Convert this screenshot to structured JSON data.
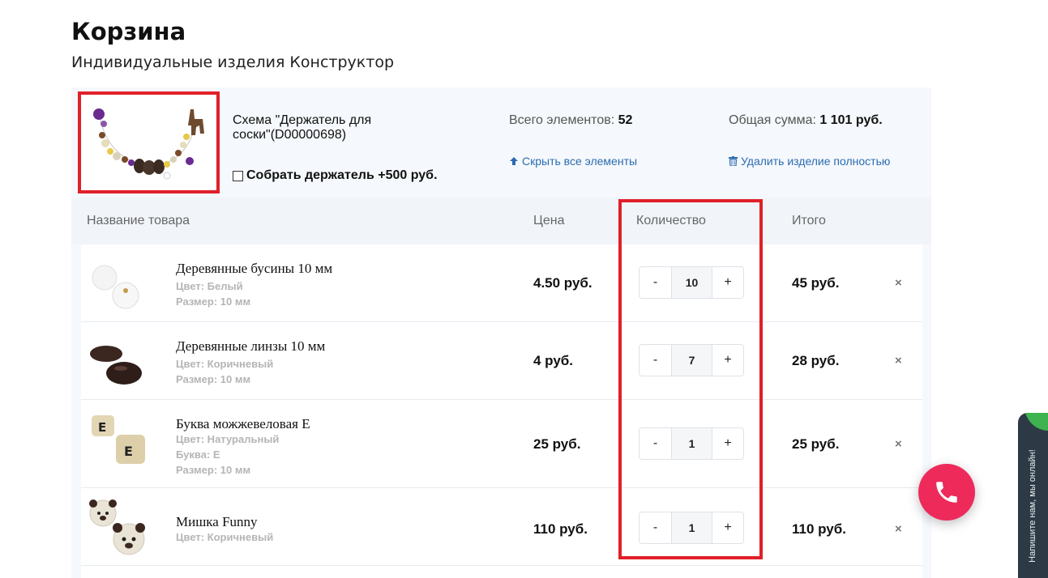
{
  "page": {
    "title": "Корзина",
    "subtitle": "Индивидуальные изделия Конструктор"
  },
  "product": {
    "scheme_title": "Схема \"Держатель для соски\"(D00000698)",
    "assemble_label": "Собрать держатель +500 руб.",
    "assemble_checked": false,
    "total_elements_label": "Всего элементов:",
    "total_elements_value": "52",
    "total_sum_label": "Общая сумма:",
    "total_sum_value": "1 101 руб.",
    "hide_all_label": "Скрыть все элементы",
    "delete_label": "Удалить изделие полностью"
  },
  "table": {
    "headers": {
      "name": "Название товара",
      "price": "Цена",
      "quantity": "Количество",
      "total": "Итого"
    },
    "rows": [
      {
        "name": "Деревянные бусины 10 мм",
        "props": [
          "Цвет: Белый",
          "Размер: 10 мм"
        ],
        "price": "4.50 руб.",
        "qty": "10",
        "total": "45 руб."
      },
      {
        "name": "Деревянные линзы 10 мм",
        "props": [
          "Цвет: Коричневый",
          "Размер: 10 мм"
        ],
        "price": "4 руб.",
        "qty": "7",
        "total": "28 руб."
      },
      {
        "name": "Буква можжевеловая E",
        "props": [
          "Цвет: Натуральный",
          "Буква: E",
          "Размер: 10 мм"
        ],
        "price": "25 руб.",
        "qty": "1",
        "total": "25 руб."
      },
      {
        "name": "Мишка Funny",
        "props": [
          "Цвет: Коричневый"
        ],
        "price": "110 руб.",
        "qty": "1",
        "total": "110 руб."
      }
    ],
    "minus_label": "-",
    "plus_label": "+",
    "remove_label": "×"
  },
  "widgets": {
    "chat_label": "Напишите нам, мы онлайн!"
  },
  "colors": {
    "highlight": "#e02029",
    "link": "#2b6cb0",
    "call_button": "#ee2a5b",
    "chat_bg": "#2d3a45",
    "online_green": "#3fb34f"
  },
  "icons": {
    "hide": "arrow-up-icon",
    "delete": "trash-icon",
    "call": "phone-icon",
    "remove": "close-icon"
  }
}
